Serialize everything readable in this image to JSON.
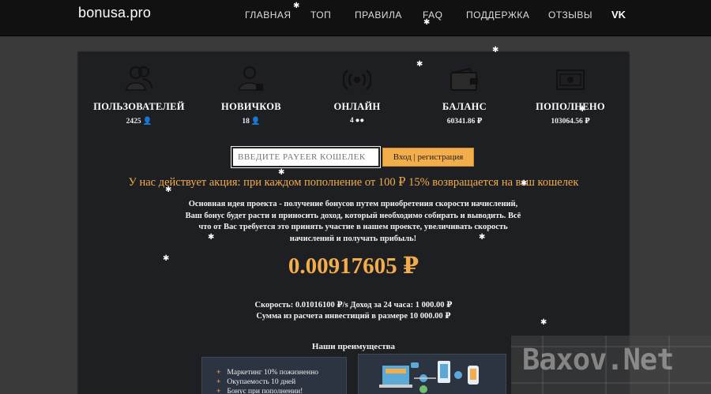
{
  "site": {
    "logo": "bonusa.pro"
  },
  "nav": {
    "items": [
      {
        "label": "ГЛАВНАЯ"
      },
      {
        "label": "ТОП"
      },
      {
        "label": "ПРАВИЛА"
      },
      {
        "label": "FAQ"
      },
      {
        "label": "ПОДДЕРЖКА"
      },
      {
        "label": "ОТЗЫВЫ"
      }
    ],
    "social": "VK"
  },
  "stats": [
    {
      "label": "ПОЛЬЗОВАТЕЛЕЙ",
      "value": "2425",
      "icon": "users-icon"
    },
    {
      "label": "НОВИЧКОВ",
      "value": "18",
      "icon": "new-users-icon"
    },
    {
      "label": "ОНЛАЙН",
      "value": "4",
      "icon": "online-icon"
    },
    {
      "label": "БАЛАНС",
      "value": "60341.86 ₽",
      "icon": "wallet-icon"
    },
    {
      "label": "ПОПОЛНЕНО",
      "value": "103064.56 ₽",
      "icon": "cash-icon"
    }
  ],
  "login": {
    "placeholder": "ВВЕДИТЕ PAYEER КОШЕЛЕК",
    "button": "Вход | регистрация"
  },
  "promo": "У нас действует акция: при каждом пополнение от 100 ₽ 15% возвращается на ваш кошелек",
  "description": "Основная идея проекта - получение бонусов путем приобретения скорости начислений, Ваш бонус будет расти и приносить доход, который необходимо собирать и выводить. Всё что от Вас требуется это принять участие в нашем проекте, увеличивать скорость начислений и получать прибыль!",
  "counter": "0.00917605 ₽",
  "speed_line": "Скорость: 0.01016100 ₽/s Доход за 24 часа: 1 000.00 ₽",
  "invest_line": "Сумма из расчета инвестиций в размере 10 000.00 ₽",
  "advantages": {
    "title": "Наши преимущества",
    "items": [
      "Маркетинг 10% пожизненно",
      "Окупаемость 10 дней",
      "Бонус при пополнении!"
    ]
  },
  "watermark": "Baxov.Net",
  "colors": {
    "accent": "#f3ad4a",
    "panel": "#1e1f22",
    "header": "#111111",
    "background": "#3a3a3a"
  }
}
